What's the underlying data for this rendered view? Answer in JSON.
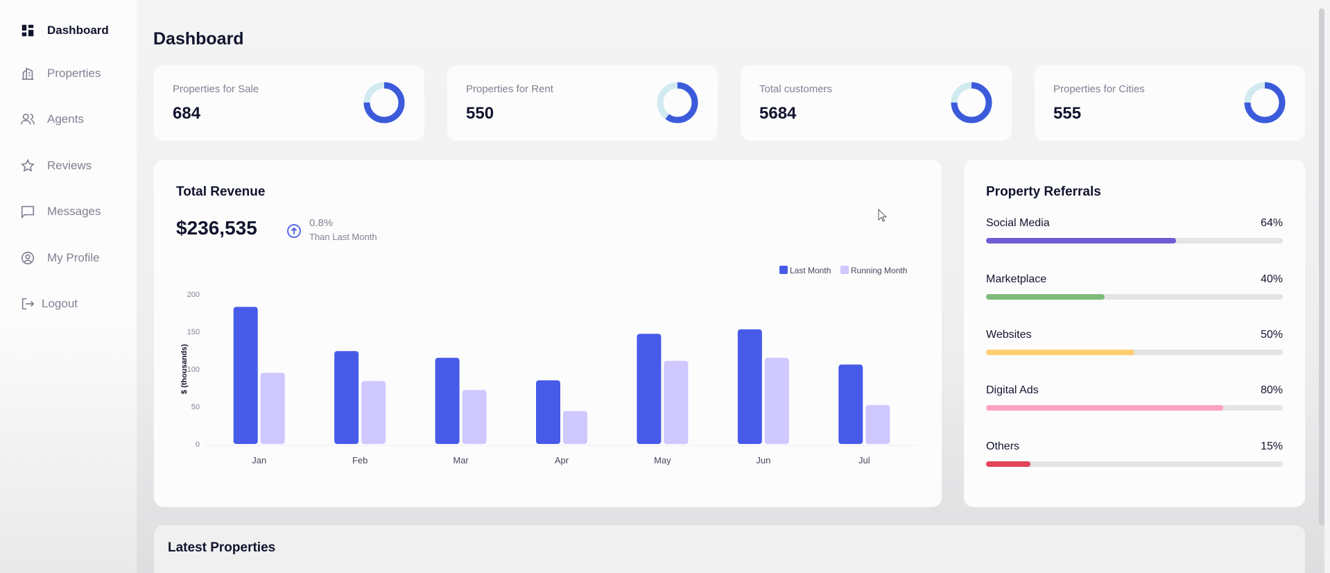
{
  "sidebar": {
    "items": [
      {
        "label": "Dashboard",
        "icon": "dashboard-icon",
        "active": true
      },
      {
        "label": "Properties",
        "icon": "building-icon"
      },
      {
        "label": "Agents",
        "icon": "people-icon"
      },
      {
        "label": "Reviews",
        "icon": "star-icon"
      },
      {
        "label": "Messages",
        "icon": "chat-icon"
      },
      {
        "label": "My Profile",
        "icon": "user-circle-icon"
      },
      {
        "label": "Logout",
        "icon": "logout-icon"
      }
    ]
  },
  "header": {
    "title": "Dashboard"
  },
  "stats": [
    {
      "label": "Properties for Sale",
      "value": "684",
      "progress": 0.75
    },
    {
      "label": "Properties for Rent",
      "value": "550",
      "progress": 0.6
    },
    {
      "label": "Total customers",
      "value": "5684",
      "progress": 0.75
    },
    {
      "label": "Properties for Cities",
      "value": "555",
      "progress": 0.75
    }
  ],
  "revenue": {
    "title": "Total Revenue",
    "value": "$236,535",
    "trend_pct": "0.8%",
    "trend_text": "Than Last Month"
  },
  "chart_data": {
    "type": "bar",
    "categories": [
      "Jan",
      "Feb",
      "Mar",
      "Apr",
      "May",
      "Jun",
      "Jul"
    ],
    "series": [
      {
        "name": "Last Month",
        "values": [
          183,
          124,
          115,
          85,
          147,
          153,
          106
        ]
      },
      {
        "name": "Running Month",
        "values": [
          95,
          84,
          72,
          44,
          111,
          115,
          52
        ]
      }
    ],
    "yticks": [
      0,
      50,
      100,
      150,
      200
    ],
    "ylabel": "$ (thousands)",
    "ylim": [
      0,
      200
    ],
    "legend": "top-right"
  },
  "referrals": {
    "title": "Property Referrals",
    "items": [
      {
        "name": "Social Media",
        "pct": "64%",
        "value": 64,
        "color": "#6c5dd3"
      },
      {
        "name": "Marketplace",
        "pct": "40%",
        "value": 40,
        "color": "#7fba7a"
      },
      {
        "name": "Websites",
        "pct": "50%",
        "value": 50,
        "color": "#ffce73"
      },
      {
        "name": "Digital Ads",
        "pct": "80%",
        "value": 80,
        "color": "#ffa2c0"
      },
      {
        "name": "Others",
        "pct": "15%",
        "value": 15,
        "color": "#e2445c"
      }
    ]
  },
  "latest": {
    "title": "Latest Properties"
  },
  "colors": {
    "bar_last": "#475be8",
    "bar_running": "#cfc8ff",
    "donut_fill": "#3b5bdb",
    "donut_track": "#d0eaf0"
  }
}
